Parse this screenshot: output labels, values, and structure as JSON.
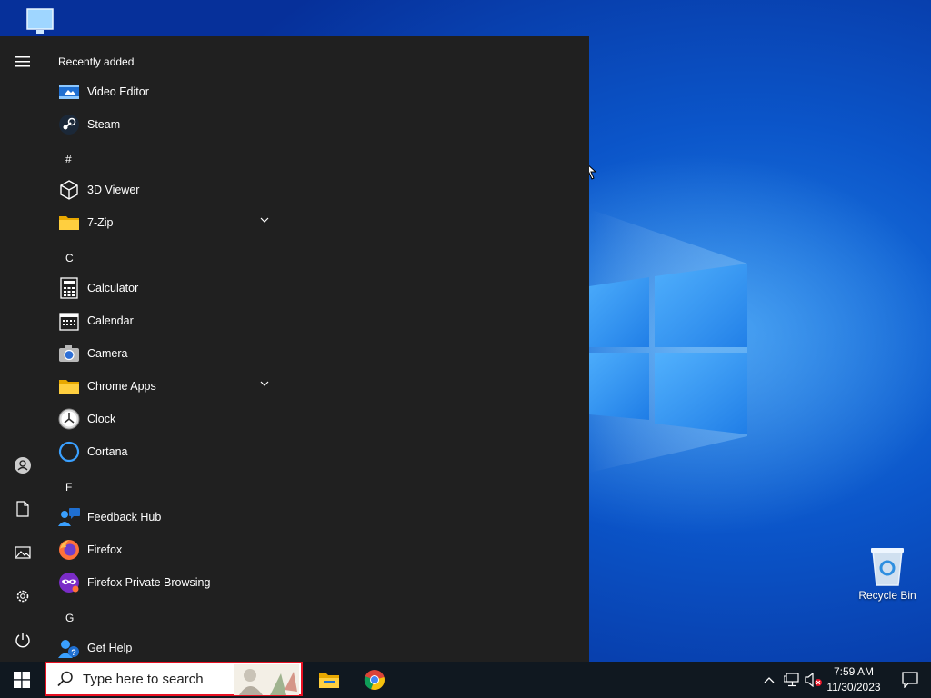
{
  "desktop": {
    "recycle_bin_label": "Recycle Bin"
  },
  "start_menu": {
    "rail": {
      "items": [
        {
          "name": "expand",
          "icon": "hamburger-menu-icon"
        },
        {
          "name": "account",
          "icon": "user-icon"
        },
        {
          "name": "documents",
          "icon": "document-icon"
        },
        {
          "name": "pictures",
          "icon": "pictures-icon"
        },
        {
          "name": "settings",
          "icon": "gear-icon"
        },
        {
          "name": "power",
          "icon": "power-icon"
        }
      ]
    },
    "recently_added_header": "Recently added",
    "letters": {
      "hash": "#",
      "c": "C",
      "f": "F",
      "g": "G"
    },
    "apps": {
      "video_editor": "Video Editor",
      "steam": "Steam",
      "viewer_3d": "3D Viewer",
      "seven_zip": "7-Zip",
      "calculator": "Calculator",
      "calendar": "Calendar",
      "camera": "Camera",
      "chrome_apps": "Chrome Apps",
      "clock": "Clock",
      "cortana": "Cortana",
      "feedback_hub": "Feedback Hub",
      "firefox": "Firefox",
      "firefox_private": "Firefox Private Browsing",
      "get_help": "Get Help"
    }
  },
  "taskbar": {
    "search_placeholder": "Type here to search",
    "pinned": [
      "File Explorer",
      "Google Chrome"
    ],
    "time": "7:59 AM",
    "date": "11/30/2023"
  },
  "colors": {
    "start_bg": "#202020",
    "taskbar_bg": "#101820",
    "accent": "#0078d7",
    "search_border": "#e81123"
  }
}
